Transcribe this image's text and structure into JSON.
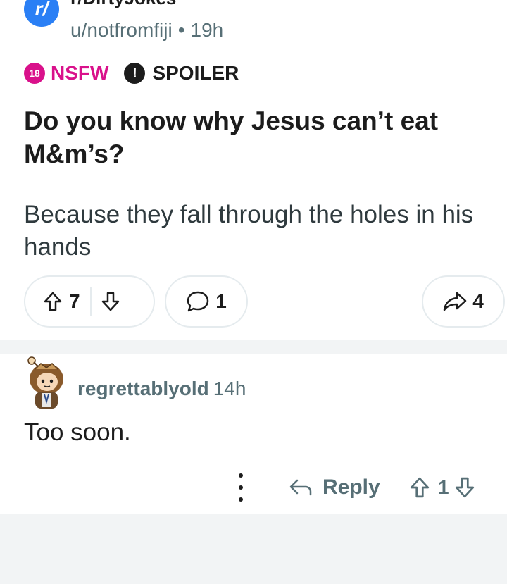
{
  "post": {
    "subreddit": "r/DirtyJokes",
    "subreddit_icon_letter": "r/",
    "author": "u/notfromfiji",
    "separator": "•",
    "age": "19h",
    "nsfw_badge": "18",
    "nsfw_label": "NSFW",
    "spoiler_icon": "!",
    "spoiler_label": "SPOILER",
    "title": "Do you know why Jesus can’t eat M&m’s?",
    "body": "Because they fall through the holes in his hands",
    "upvotes": "7",
    "comments": "1",
    "shares": "4"
  },
  "comment": {
    "author": "regrettablyold",
    "age": "14h",
    "text": "Too soon.",
    "reply_label": "Reply",
    "votes": "1"
  },
  "colors": {
    "nsfw": "#d9118b",
    "subreddit_blue": "#2a7ff5",
    "muted": "#576f76",
    "border": "#e5ebee",
    "band": "#f2f4f5"
  },
  "icons": {
    "subreddit": "subreddit-icon",
    "upvote": "upvote-arrow-icon",
    "downvote": "downvote-arrow-icon",
    "comment": "comment-bubble-icon",
    "share": "share-arrow-icon",
    "more": "more-vertical-icon",
    "reply": "reply-arrow-icon",
    "avatar": "snoo-avatar"
  }
}
